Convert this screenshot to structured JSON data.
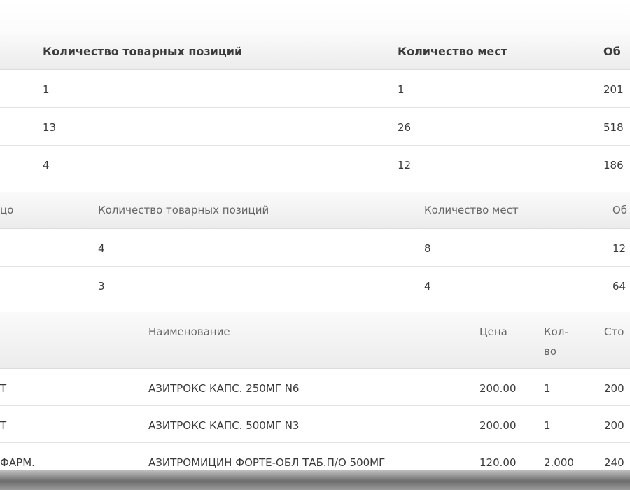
{
  "table1": {
    "headers": [
      "Количество товарных позиций",
      "Количество мест",
      "Об"
    ],
    "rows": [
      [
        "1",
        "1",
        "201"
      ],
      [
        "13",
        "26",
        "518"
      ],
      [
        "4",
        "12",
        "186"
      ]
    ]
  },
  "table2": {
    "headers": [
      "цо",
      "Количество товарных позиций",
      "Количество мест",
      "Об"
    ],
    "rows": [
      [
        "4",
        "8",
        "12"
      ],
      [
        "3",
        "4",
        "64"
      ]
    ]
  },
  "table3": {
    "headers": [
      "Наименование",
      "Цена",
      "Кол-",
      "во",
      "Сто"
    ],
    "rows": [
      [
        "Т",
        "АЗИТРОКС КАПС. 250МГ N6",
        "200.00",
        "1",
        "200"
      ],
      [
        "Т",
        "АЗИТРОКС КАПС. 500МГ N3",
        "200.00",
        "1",
        "200"
      ],
      [
        "ФАРМ.",
        "АЗИТРОМИЦИН ФОРТЕ-ОБЛ ТАБ.П/О 500МГ",
        "120.00",
        "2.000",
        "240"
      ]
    ]
  }
}
